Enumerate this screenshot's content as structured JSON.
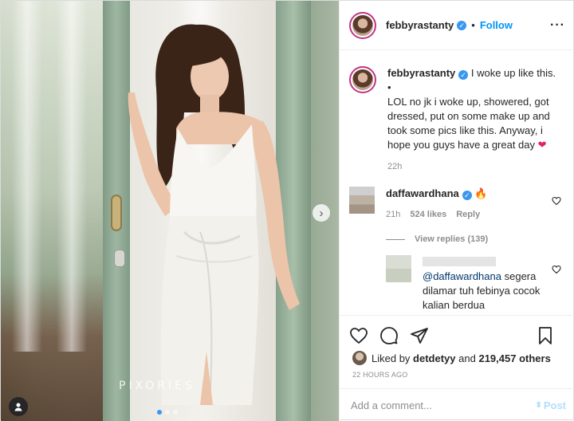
{
  "post": {
    "watermark": "PIXORIES",
    "image_count": 3,
    "active_index": 0
  },
  "header": {
    "username": "febbyrastanty",
    "separator": "•",
    "follow_label": "Follow",
    "more_label": "···"
  },
  "caption": {
    "username": "febbyrastanty",
    "first_line": "I woke up like this.",
    "bullet": "•",
    "body": "LOL no jk i woke up, showered, got dressed, put on some make up and took some pics like this. Anyway, i hope you guys have a great day",
    "time": "22h"
  },
  "comment": {
    "username": "daffawardhana",
    "emoji": "🔥",
    "time": "21h",
    "likes": "524 likes",
    "reply_label": "Reply",
    "view_replies": "View replies (139)"
  },
  "reply": {
    "mention": "@daffawardhana",
    "text": "segera dilamar tuh febinya cocok kalian berdua"
  },
  "likes": {
    "prefix": "Liked by",
    "user": "detdetyy",
    "middle": "and",
    "count": "219,457 others"
  },
  "date": "22 HOURS AGO",
  "add_comment": {
    "placeholder": "Add a comment...",
    "post_label": "Post"
  },
  "colors": {
    "link_blue": "#0095f6",
    "verified": "#3897f0",
    "heart_red": "#e0245e",
    "muted": "#8e8e8e"
  }
}
